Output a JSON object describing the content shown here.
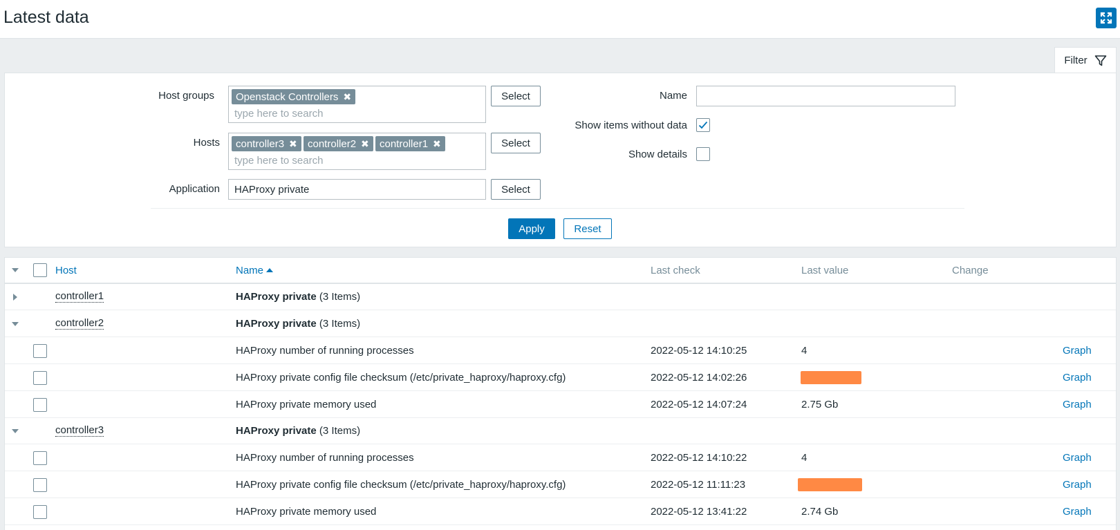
{
  "page": {
    "title": "Latest data"
  },
  "icons": {
    "fullscreen": "fullscreen-icon",
    "filter": "filter-icon"
  },
  "colors": {
    "accent": "#0275b8",
    "chip": "#768d99",
    "redaction": "#ff8944"
  },
  "filter": {
    "tab_label": "Filter",
    "host_groups": {
      "label": "Host groups",
      "chips": [
        "Openstack Controllers"
      ],
      "placeholder": "type here to search",
      "select_label": "Select"
    },
    "hosts": {
      "label": "Hosts",
      "chips": [
        "controller3",
        "controller2",
        "controller1"
      ],
      "placeholder": "type here to search",
      "select_label": "Select"
    },
    "application": {
      "label": "Application",
      "value": "HAProxy private",
      "select_label": "Select"
    },
    "name": {
      "label": "Name",
      "value": ""
    },
    "show_items_without_data": {
      "label": "Show items without data",
      "checked": true
    },
    "show_details": {
      "label": "Show details",
      "checked": false
    },
    "apply_label": "Apply",
    "reset_label": "Reset"
  },
  "table": {
    "columns": {
      "host": "Host",
      "name": "Name",
      "last_check": "Last check",
      "last_value": "Last value",
      "change": "Change"
    },
    "groups": [
      {
        "host": "controller1",
        "app": "HAProxy private",
        "count": "(3 Items)",
        "expanded": false,
        "items": []
      },
      {
        "host": "controller2",
        "app": "HAProxy private",
        "count": "(3 Items)",
        "expanded": true,
        "items": [
          {
            "name": "HAProxy number of running processes",
            "last_check": "2022-05-12 14:10:25",
            "last_value": "4",
            "redacted": false,
            "link": "Graph"
          },
          {
            "name": "HAProxy private config file checksum (/etc/private_haproxy/haproxy.cfg)",
            "last_check": "2022-05-12 14:02:26",
            "last_value": "",
            "redacted": true,
            "link": "Graph"
          },
          {
            "name": "HAProxy private memory used",
            "last_check": "2022-05-12 14:07:24",
            "last_value": "2.75 Gb",
            "redacted": false,
            "link": "Graph"
          }
        ]
      },
      {
        "host": "controller3",
        "app": "HAProxy private",
        "count": "(3 Items)",
        "expanded": true,
        "items": [
          {
            "name": "HAProxy number of running processes",
            "last_check": "2022-05-12 14:10:22",
            "last_value": "4",
            "redacted": false,
            "link": "Graph"
          },
          {
            "name": "HAProxy private config file checksum (/etc/private_haproxy/haproxy.cfg)",
            "last_check": "2022-05-12 11:11:23",
            "last_value": "",
            "redacted": true,
            "link": "Graph"
          },
          {
            "name": "HAProxy private memory used",
            "last_check": "2022-05-12 13:41:22",
            "last_value": "2.74 Gb",
            "redacted": false,
            "link": "Graph"
          }
        ]
      }
    ]
  }
}
